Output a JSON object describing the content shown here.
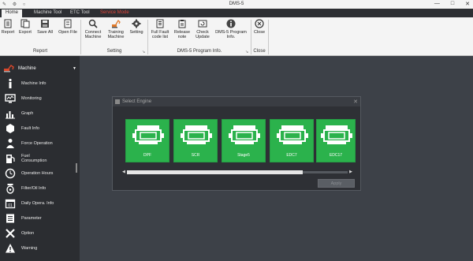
{
  "window": {
    "title": "DMS-5",
    "controls": [
      "—",
      "□",
      "✕"
    ],
    "quick_access": "✎ ⚙ ○"
  },
  "tabs": [
    {
      "label": "Home"
    },
    {
      "label": "Machine Tool"
    },
    {
      "label": "ETC Tool"
    },
    {
      "label": "Service Mode"
    }
  ],
  "ribbon": {
    "buttons": [
      {
        "label": "Report",
        "icon": "report-icon"
      },
      {
        "label": "Export",
        "icon": "export-icon"
      },
      {
        "label": "Save All",
        "icon": "save-all-icon"
      },
      {
        "label": "Open File",
        "icon": "open-file-icon"
      },
      {
        "label": "Connect\nMachine",
        "icon": "search-icon"
      },
      {
        "label": "Training\nMachine",
        "icon": "excavator-icon"
      },
      {
        "label": "Setting",
        "icon": "gear-icon"
      },
      {
        "label": "Full Fault\ncode list",
        "icon": "document-icon"
      },
      {
        "label": "Release\nnote",
        "icon": "clipboard-icon"
      },
      {
        "label": "Check\nUpdate",
        "icon": "update-icon"
      },
      {
        "label": "DMS-5 Program\nInfo.",
        "icon": "info-icon"
      },
      {
        "label": "Close",
        "icon": "close-circle-icon"
      }
    ],
    "groups": [
      {
        "label": "Report"
      },
      {
        "label": "Setting"
      },
      {
        "label": "DMS-5 Program Info."
      },
      {
        "label": "Close"
      }
    ]
  },
  "sidebar": {
    "header": "Machine",
    "items": [
      {
        "label": "Machine Info",
        "icon": "info-icon"
      },
      {
        "label": "Monitoring",
        "icon": "monitor-icon"
      },
      {
        "label": "Graph",
        "icon": "bar-chart-icon"
      },
      {
        "label": "Fault Info",
        "icon": "engine-icon"
      },
      {
        "label": "Force Operation",
        "icon": "person-icon"
      },
      {
        "label": "Fuel\nConsumption",
        "icon": "fuel-icon"
      },
      {
        "label": "Operation Hours",
        "icon": "clock-icon"
      },
      {
        "label": "Filter/Oil Info",
        "icon": "oil-filter-icon"
      },
      {
        "label": "Daily Opera. Info",
        "icon": "calendar-icon"
      },
      {
        "label": "Parameter",
        "icon": "list-icon"
      },
      {
        "label": "Option",
        "icon": "wrench-icon"
      },
      {
        "label": "Warning",
        "icon": "warning-icon"
      }
    ]
  },
  "dialog": {
    "title": "Select Engine",
    "engines": [
      {
        "label": "DPF"
      },
      {
        "label": "SCR"
      },
      {
        "label": "Stage5"
      },
      {
        "label": "EDC7"
      },
      {
        "label": "EDC17"
      }
    ],
    "apply_label": "Apply",
    "scroll_left": "◀",
    "scroll_right": "▶"
  },
  "colors": {
    "accent_green": "#2bb24c",
    "service_mode_red": "#e0453a",
    "sidebar_bg": "#2b2d31"
  }
}
